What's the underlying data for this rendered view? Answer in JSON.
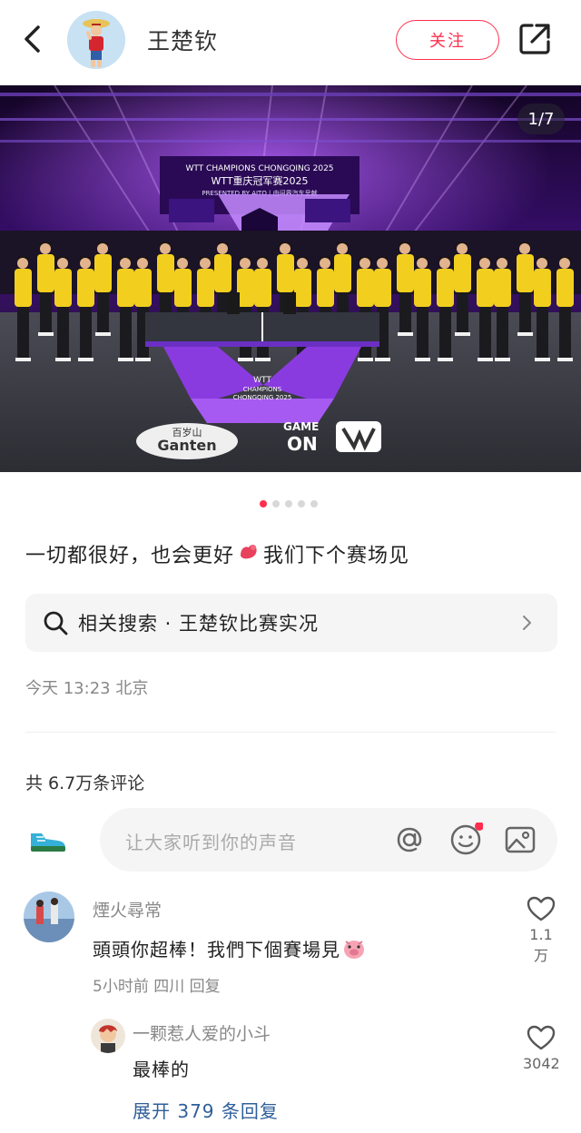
{
  "header": {
    "author_name": "王楚钦",
    "follow_label": "关注"
  },
  "photo": {
    "counter": "1/7",
    "banner_line1": "WTT CHAMPIONS CHONGQING 2025",
    "banner_line2": "WTT重庆冠军赛2025",
    "banner_line3": "PRESENTED BY AITO | 由问界汽车呈献",
    "table_brand_line1": "WTT",
    "table_brand_line2": "CHAMPIONS",
    "table_brand_line3": "CHONGQING 2025",
    "sponsor_line1": "百岁山",
    "sponsor_line2": "Ganten",
    "game_on_line1": "GAME",
    "game_on_line2": "ON",
    "colors": {
      "stage_purple": "#7a2bd6",
      "jersey_yellow": "#f2cf1f"
    }
  },
  "carousel": {
    "total_dots": 5,
    "active_index": 0
  },
  "post": {
    "caption_part1": "一切都很好，也会更好",
    "caption_part2": "我们下个赛场见",
    "related_search_label": "相关搜索 · 王楚钦比赛实况",
    "time_location": "今天 13:23 北京"
  },
  "comments_section": {
    "count_text": "共 6.7万条评论",
    "input_placeholder": "让大家听到你的声音"
  },
  "comments": [
    {
      "user": "煙火尋常",
      "text": "頭頭你超棒！我們下個賽場見",
      "meta": "5小时前  四川  回复",
      "likes": "1.1万"
    },
    {
      "user": "一颗惹人爱的小斗",
      "text": "最棒的",
      "likes": "3042"
    }
  ],
  "expand_replies_label": "展开 379 条回复",
  "accent_color": "#ff2e4d",
  "icons": [
    "back-icon",
    "share-icon",
    "search-icon",
    "chevron-right-icon",
    "at-icon",
    "emoji-icon",
    "image-icon",
    "heart-icon",
    "sneaker-icon",
    "muscle-emoji-icon",
    "pig-emoji-icon"
  ]
}
